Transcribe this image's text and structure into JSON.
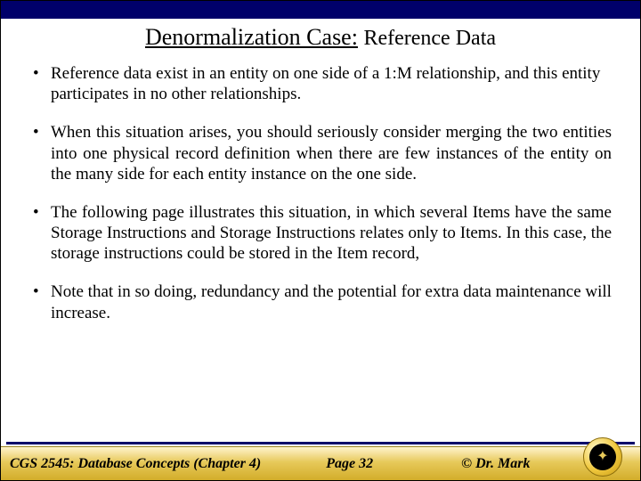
{
  "title": {
    "main": "Denormalization Case:",
    "sub": "Reference Data"
  },
  "bullets": [
    "Reference data exist in an entity on one side of a 1:M relationship, and this entity participates in no other relationships.",
    "When this situation arises, you should seriously consider merging the two entities into one physical record definition when there are few instances of the entity on the many side for each entity instance on the one side.",
    "The following page illustrates this situation, in which several Items have the same Storage Instructions and Storage Instructions relates only to Items.  In this case, the storage instructions could be stored in the Item record,",
    "Note that in so doing, redundancy and the potential for extra data maintenance will increase."
  ],
  "footer": {
    "course": "CGS 2545: Database Concepts  (Chapter 4)",
    "page": "Page 32",
    "copyright": "© Dr. Mark"
  }
}
